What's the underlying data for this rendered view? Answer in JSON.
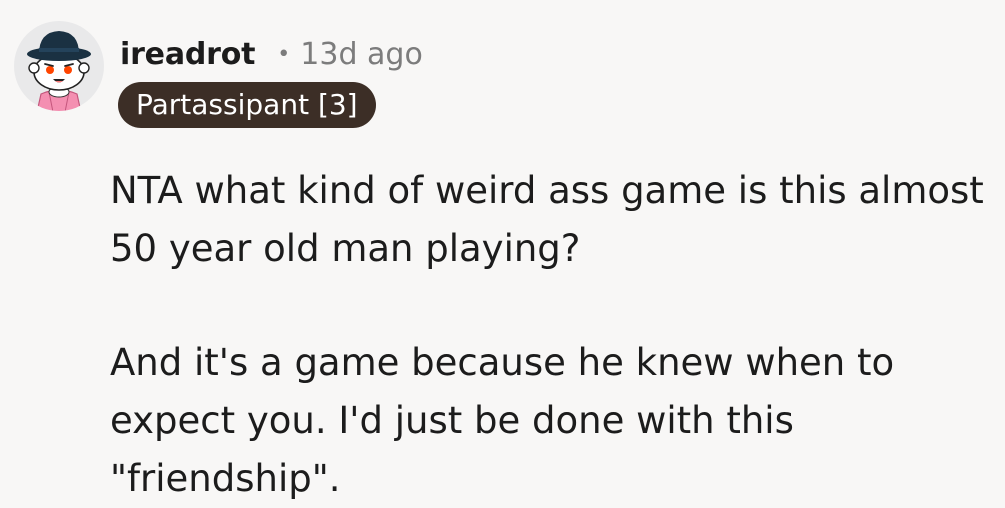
{
  "comment": {
    "author": "ireadrot",
    "separator": "•",
    "timestamp": "13d ago",
    "flair": "Partassipant [3]",
    "paragraphs": [
      "NTA what kind of weird ass game is this almost 50 year old man playing?",
      "And it's a game because he knew when to expect you. I'd just be done with this \"friendship\"."
    ]
  },
  "colors": {
    "background": "#f8f7f6",
    "flair_background": "#3c2e26",
    "flair_text": "#ffffff",
    "meta_text": "#7c7c7c",
    "body_text": "#1c1c1c",
    "avatar_hat": "#1a3142",
    "avatar_shirt": "#f48fb1"
  },
  "icons": {
    "avatar": "snoo-avatar-with-hat-icon"
  }
}
